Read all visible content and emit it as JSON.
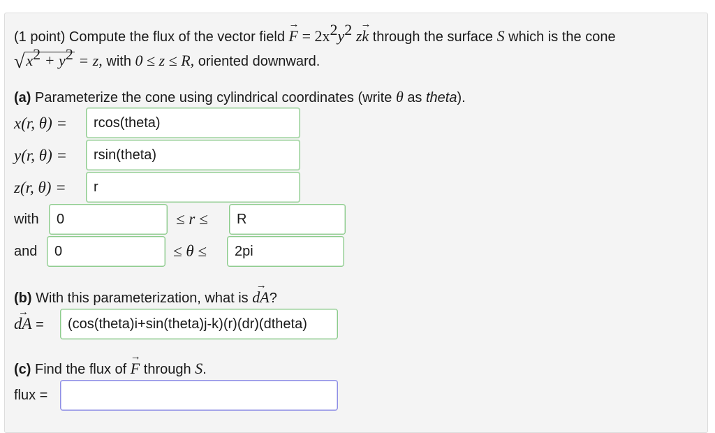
{
  "question": {
    "prefix": "(1 point) Compute the flux of the vector field",
    "field_F": "F",
    "field_eq": "= 2x",
    "exp2a": "2",
    "field_y": "y",
    "exp2b": "2",
    "field_z": "z",
    "field_k": "k",
    "mid": "through the surface",
    "surface": "S",
    "tail": "which is the cone",
    "sqrt_x": "x",
    "sqrt_exp1": "2",
    "sqrt_plus": "+ y",
    "sqrt_exp2": "2",
    "eq_z": "= z,",
    "with_text": "with",
    "range": "0 ≤ z ≤ R,",
    "orient": "oriented downward."
  },
  "part_a": {
    "label": "(a)",
    "text": "Parameterize the cone using cylindrical coordinates (write",
    "theta_sym": "θ",
    "as_text": "as",
    "theta_word": "theta",
    "close": ")."
  },
  "params": {
    "x_label": "x(r, θ) =",
    "x_value": "rcos(theta)",
    "y_label": "y(r, θ) =",
    "y_value": "rsin(theta)",
    "z_label": "z(r, θ) =",
    "z_value": "r"
  },
  "bounds": {
    "with_label": "with",
    "r_lower": "0",
    "r_ineq": "≤ r ≤",
    "r_upper": "R",
    "and_label": "and",
    "t_lower": "0",
    "t_ineq": "≤ θ ≤",
    "t_upper": "2pi"
  },
  "part_b": {
    "label": "(b)",
    "text": "With this parameterization, what is",
    "dA": "dA",
    "q": "?",
    "dA_label": "dA",
    "eq": "=",
    "dA_value": "(cos(theta)i+sin(theta)j-k)(r)(dr)(dtheta)"
  },
  "part_c": {
    "label": "(c)",
    "text": "Find the flux of",
    "F": "F",
    "through": "through",
    "S": "S",
    "period": ".",
    "flux_label": "flux =",
    "flux_value": ""
  }
}
